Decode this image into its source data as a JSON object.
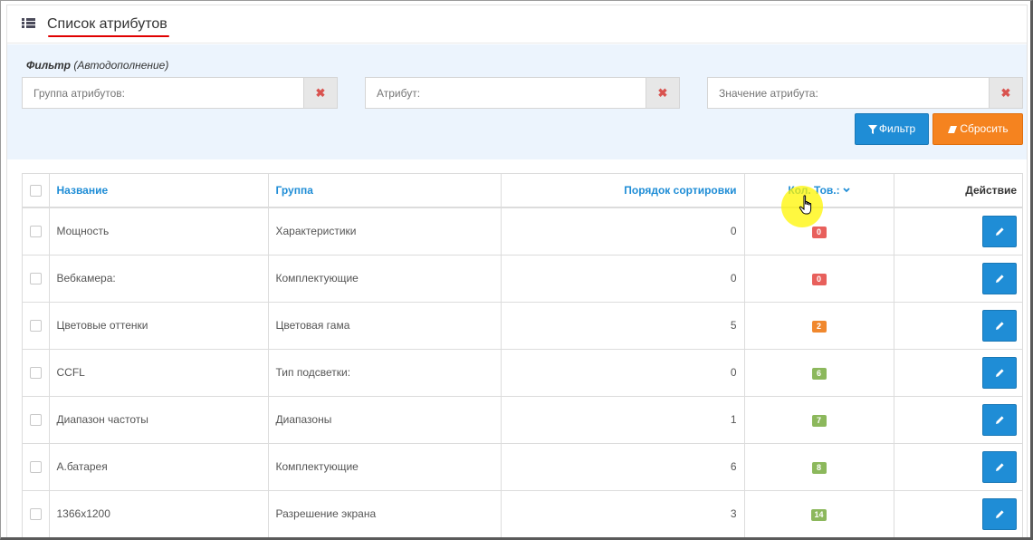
{
  "header": {
    "title": "Список атрибутов",
    "icon": "list-icon"
  },
  "filter": {
    "heading_bold": "Фильтр",
    "heading_italic": " (Автодополнение)",
    "fields": [
      {
        "placeholder": "Группа атрибутов:",
        "value": ""
      },
      {
        "placeholder": "Атрибут:",
        "value": ""
      },
      {
        "placeholder": "Значение атрибута:",
        "value": ""
      }
    ],
    "clear_symbol": "✖",
    "filter_button": "Фильтр",
    "reset_button": "Сбросить"
  },
  "table": {
    "columns": {
      "name": "Название",
      "group": "Группа",
      "sort_order": "Порядок сортировки",
      "count": "Кол. Тов.:",
      "action": "Действие"
    },
    "rows": [
      {
        "name": "Мощность",
        "group": "Характеристики",
        "sort_order": "0",
        "count": "0",
        "badge_color": "#e8605c"
      },
      {
        "name": "Вебкамера:",
        "group": "Комплектующие",
        "sort_order": "0",
        "count": "0",
        "badge_color": "#e8605c"
      },
      {
        "name": "Цветовые оттенки",
        "group": "Цветовая гама",
        "sort_order": "5",
        "count": "2",
        "badge_color": "#f0882e"
      },
      {
        "name": "CCFL",
        "group": "Тип подсветки:",
        "sort_order": "0",
        "count": "6",
        "badge_color": "#8cb85c"
      },
      {
        "name": "Диапазон частоты",
        "group": "Диапазоны",
        "sort_order": "1",
        "count": "7",
        "badge_color": "#8cb85c"
      },
      {
        "name": "А.батарея",
        "group": "Комплектующие",
        "sort_order": "6",
        "count": "8",
        "badge_color": "#8cb85c"
      },
      {
        "name": "1366x1200",
        "group": "Разрешение экрана",
        "sort_order": "3",
        "count": "14",
        "badge_color": "#8cb85c"
      }
    ]
  },
  "colors": {
    "accent": "#1f8dd6",
    "reset": "#f5831f",
    "filter_bg": "#ecf4fd",
    "title_underline": "#e00000"
  }
}
